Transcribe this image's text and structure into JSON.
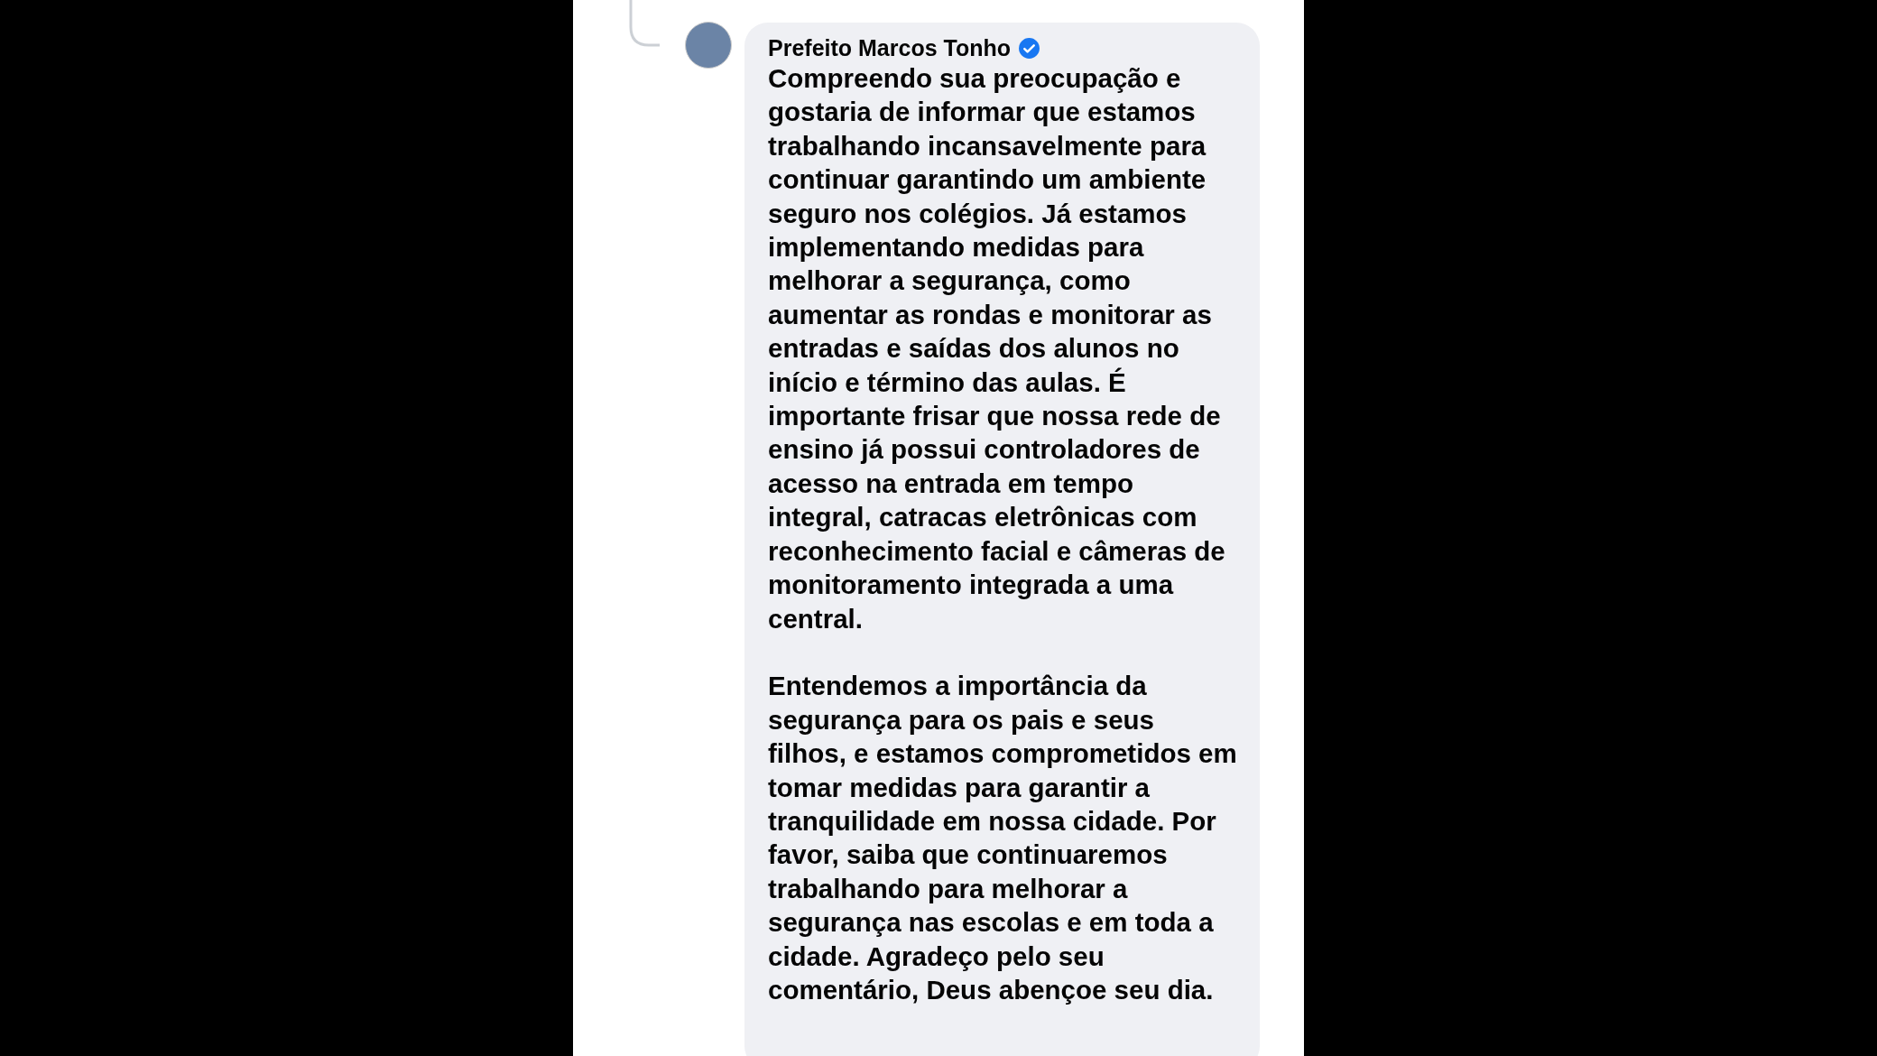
{
  "comment": {
    "author": "Prefeito Marcos Tonho",
    "verified": true,
    "paragraphs": [
      "Compreendo sua preocupação e gostaria de informar que estamos trabalhando incansavelmente para continuar garantindo um ambiente seguro nos colégios. Já estamos implementando medidas para melhorar a segurança, como aumentar as rondas e monitorar as entradas e saídas dos alunos no início e término das aulas. É importante frisar que nossa rede de ensino já possui controladores de acesso na entrada em tempo integral, catracas eletrônicas com reconhecimento facial e câmeras de monitoramento integrada a uma central.",
      "Entendemos a importância da segurança para os pais e seus filhos, e estamos comprometidos em tomar medidas para garantir a tranquilidade em nossa cidade. Por favor, saiba que continuaremos trabalhando para melhorar a segurança nas escolas e em toda a cidade. Agradeço pelo seu comentário, Deus abençoe seu dia."
    ]
  }
}
